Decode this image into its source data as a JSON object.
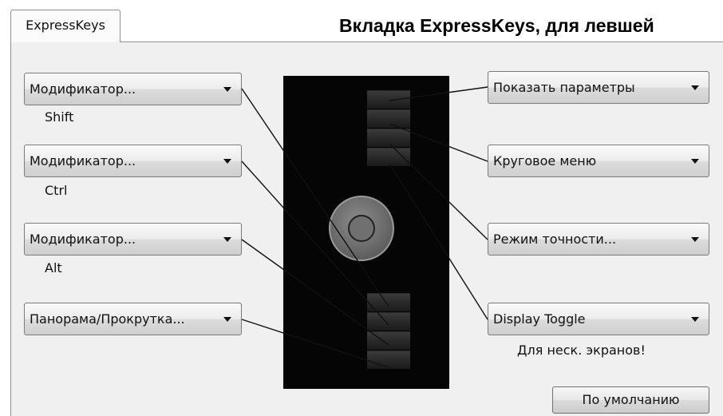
{
  "tab": {
    "label": "ExpressKeys"
  },
  "heading": "Вкладка ExpressKeys, для левшей",
  "left_keys": [
    {
      "selected": "Модификатор...",
      "sub": "Shift"
    },
    {
      "selected": "Модификатор...",
      "sub": "Ctrl"
    },
    {
      "selected": "Модификатор...",
      "sub": "Alt"
    },
    {
      "selected": "Панорама/Прокрутка...",
      "sub": ""
    }
  ],
  "right_keys": [
    {
      "selected": "Показать параметры",
      "sub": ""
    },
    {
      "selected": "Круговое меню",
      "sub": ""
    },
    {
      "selected": "Режим точности...",
      "sub": ""
    },
    {
      "selected": "Display Toggle",
      "sub": "Для неск. экранов!"
    }
  ],
  "default_button": "По умолчанию",
  "colors": {
    "panel": "#f0f0f0",
    "tablet": "#050505",
    "lines": "#111111"
  }
}
